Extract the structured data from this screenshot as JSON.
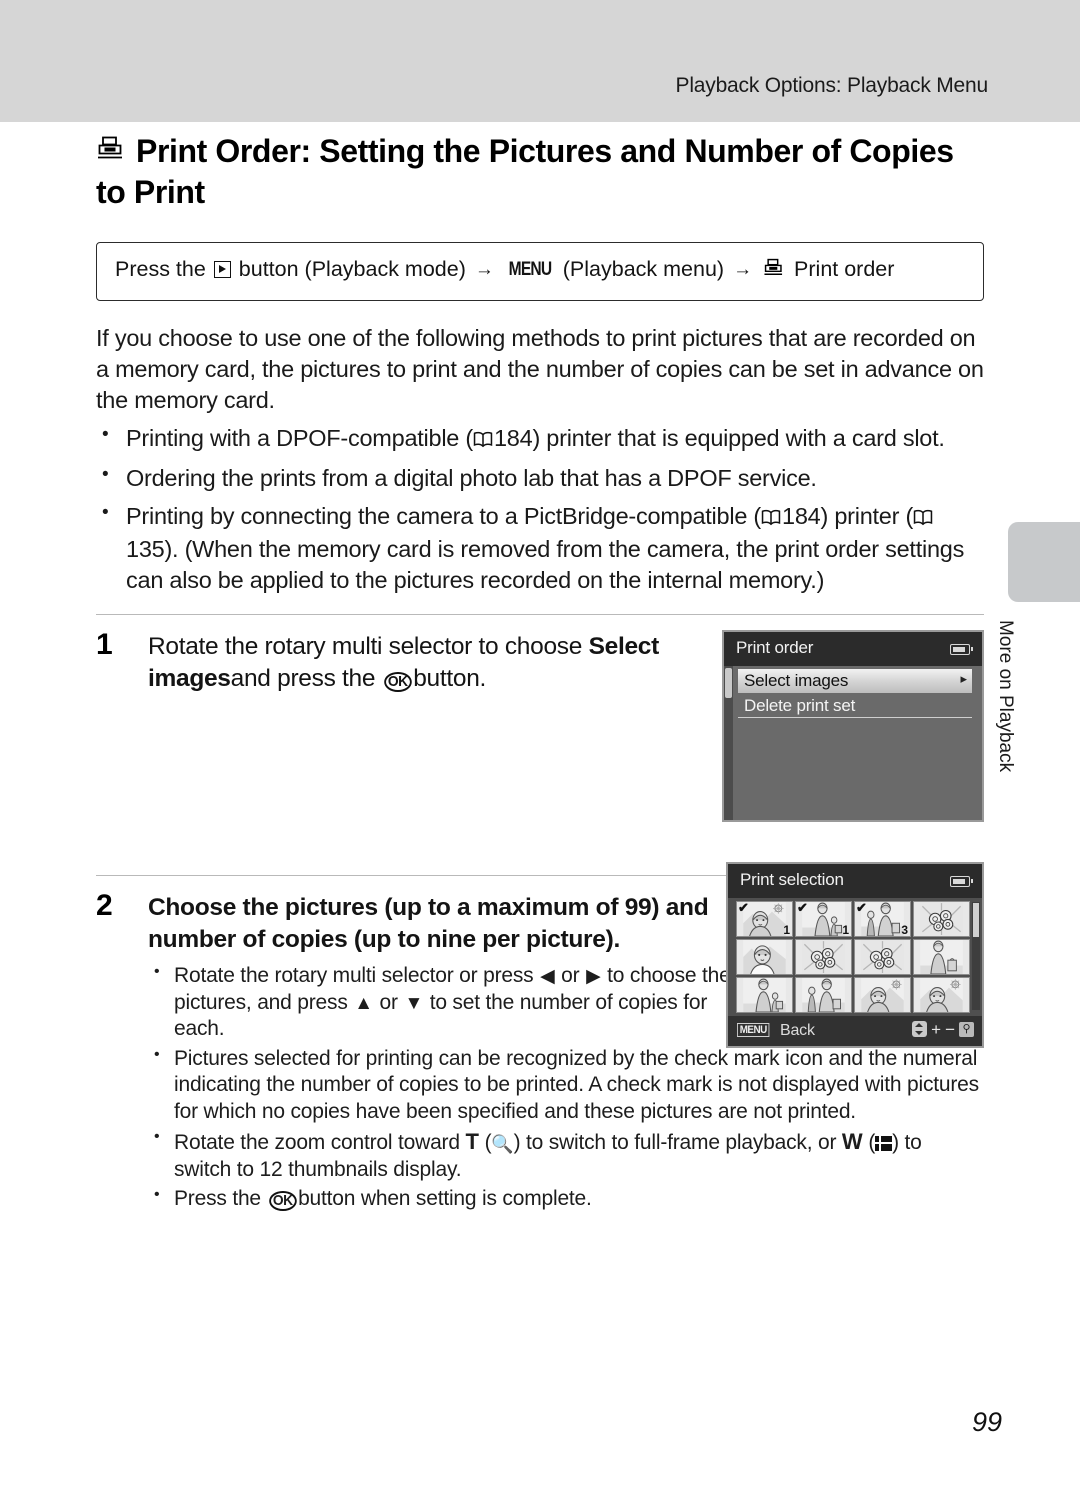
{
  "page": {
    "running_head": "Playback Options: Playback Menu",
    "folio": "99",
    "side_tab_label": "More on Playback",
    "title": "Print Order: Setting the Pictures and Number of Copies to Print"
  },
  "nav_path": {
    "prefix": "Press the",
    "play_button_icon": "playback-mode-icon",
    "after_play": "button (Playback mode)",
    "arrow1": "→",
    "menu_chip": "MENU",
    "menu_note": "(Playback menu)",
    "arrow2": "→",
    "print_order_icon": "print-order-icon",
    "destination": "Print order"
  },
  "intro": "If you choose to use one of the following methods to print pictures that are recorded on a memory card, the pictures to print and the number of copies can be set in advance on the memory card.",
  "bullets": [
    {
      "parts": [
        "Printing with a DPOF-compatible (",
        "184) printer that is equipped with a card slot."
      ],
      "refs": [
        "184"
      ]
    },
    {
      "parts": [
        "Ordering the prints from a digital photo lab that has a DPOF service."
      ],
      "refs": []
    },
    {
      "parts": [
        "Printing by connecting the camera to a PictBridge-compatible (",
        "184) printer (",
        "135). (When the memory card is removed from the camera, the print order settings can also be applied to the pictures recorded on the internal memory.)"
      ],
      "refs": [
        "184",
        "135"
      ]
    }
  ],
  "bullet_1": {
    "text_a": "Printing with a DPOF-compatible (",
    "ref_a": "184",
    "text_b": ") printer that is equipped with a card slot."
  },
  "bullet_2": {
    "text_a": "Ordering the prints from a digital photo lab that has a DPOF service."
  },
  "bullet_3": {
    "text_a": "Printing by connecting the camera to a PictBridge-compatible (",
    "ref_a": "184",
    "text_b": ") printer (",
    "ref_b": "135",
    "text_c": "). (When the memory card is removed from the camera, the print order settings can also be applied to the pictures recorded on the internal memory.)"
  },
  "steps": [
    {
      "number": "1",
      "head_a": "Rotate the rotary multi selector to choose",
      "head_bold": "Select images",
      "head_b": "and press the",
      "ok_icon": "ok-button-icon",
      "head_c": "button."
    },
    {
      "number": "2",
      "head_a": "Choose the pictures (up to a maximum of 99) and number of copies (up to nine per picture)."
    }
  ],
  "substeps": {
    "s1_a": "Rotate the rotary multi selector or press",
    "s1_left": "◀",
    "s1_or1": "or",
    "s1_right": "▶",
    "s1_b": "to choose the pictures, and press",
    "s1_up": "▲",
    "s1_or2": "or",
    "s1_down": "▼",
    "s1_c": "to set the number of copies for each.",
    "s2": "Pictures selected for printing can be recognized by the check mark icon and the numeral indicating the number of copies to be printed. A check mark is not displayed with pictures for which no copies have been specified and these pictures are not printed.",
    "s3_a": "Rotate the zoom control toward",
    "s3_t": "T",
    "s3_mag_open": "(",
    "s3_mag_icon": "magnifier-icon",
    "s3_b": ") to switch to full-frame playback, or",
    "s3_w": "W",
    "s3_thumbs_open": "(",
    "s3_thumbs_icon": "thumbnails-icon",
    "s3_c": ") to switch to 12 thumbnails display.",
    "s4_a": "Press the",
    "s4_ok": "ok-button-icon",
    "s4_b": "button when setting is complete."
  },
  "screens": {
    "print_order": {
      "title": "Print order",
      "battery_icon": "battery-icon",
      "rows": [
        {
          "label": "Select images",
          "selected": true,
          "chevron": "▸"
        },
        {
          "label": "Delete print set",
          "selected": false,
          "chevron": ""
        }
      ]
    },
    "print_selection": {
      "title": "Print selection",
      "battery_icon": "battery-icon",
      "menu_chip": "MENU",
      "back_label": "Back",
      "icons": [
        "up-down-arrows-icon",
        "plus-icon",
        "minus-icon",
        "magnifier-icon"
      ],
      "thumbnails": [
        {
          "checked": true,
          "copies": "1",
          "art": "portrait-sun"
        },
        {
          "checked": true,
          "copies": "1",
          "art": "woman-child"
        },
        {
          "checked": true,
          "copies": "3",
          "art": "child-woman"
        },
        {
          "checked": false,
          "copies": "",
          "art": "flowers"
        },
        {
          "checked": false,
          "copies": "",
          "art": "portrait-landscape"
        },
        {
          "checked": false,
          "copies": "",
          "art": "flowers"
        },
        {
          "checked": false,
          "copies": "",
          "art": "flowers"
        },
        {
          "checked": false,
          "copies": "",
          "art": "woman-bag"
        },
        {
          "checked": false,
          "copies": "",
          "art": "woman-child"
        },
        {
          "checked": false,
          "copies": "",
          "art": "child-woman"
        },
        {
          "checked": false,
          "copies": "",
          "art": "portrait-sun"
        },
        {
          "checked": false,
          "copies": "",
          "art": "portrait-sun"
        }
      ]
    }
  },
  "colors": {
    "band": "#d6d6d6",
    "tab": "#c7c9cb",
    "screen_title_bar": "#2b2b2b",
    "screen_body": "#6a6a6a",
    "text": "#1a1a1a"
  }
}
